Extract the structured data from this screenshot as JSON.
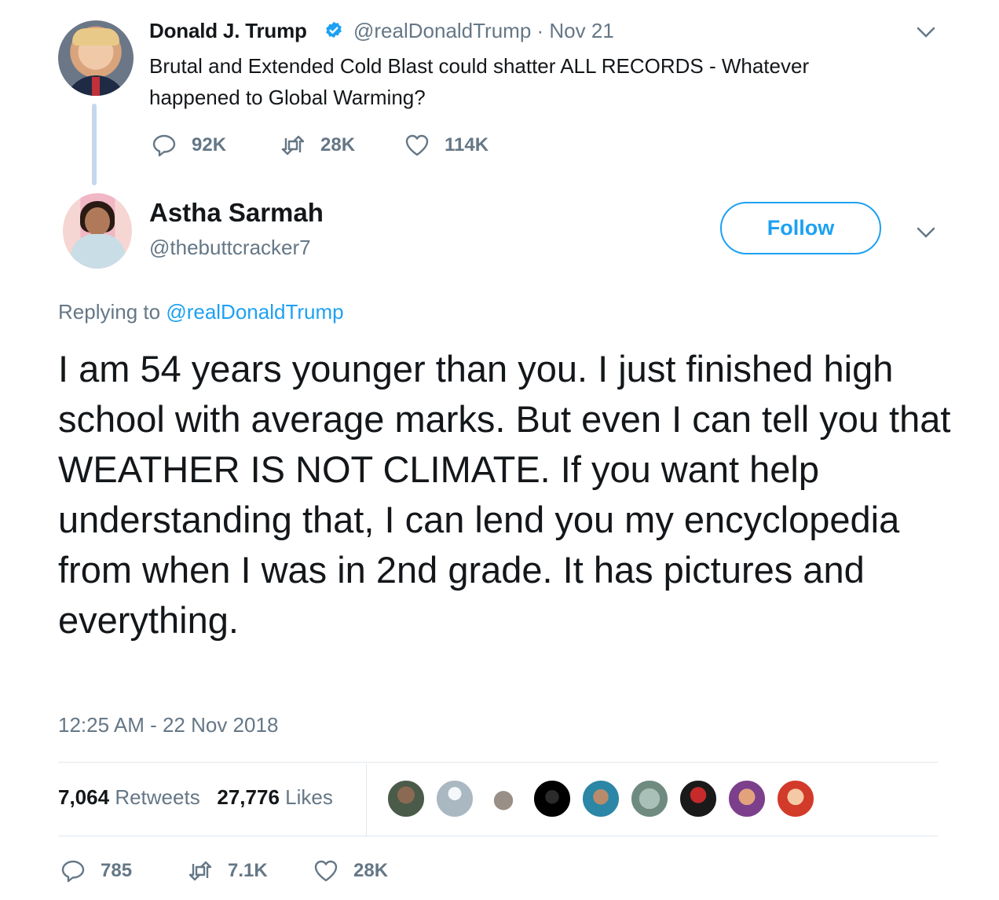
{
  "parent_tweet": {
    "name": "Donald J. Trump",
    "handle_date": "@realDonaldTrump · Nov 21",
    "text": "Brutal and Extended Cold Blast could shatter ALL RECORDS - Whatever happened to Global Warming?",
    "replies": "92K",
    "retweets": "28K",
    "likes": "114K"
  },
  "reply_tweet": {
    "name": "Astha Sarmah",
    "handle": "@thebuttcracker7",
    "follow_label": "Follow",
    "replying_prefix": "Replying to",
    "replying_handle": "@realDonaldTrump",
    "text": "I am 54 years younger than you. I just finished high school with average marks. But even I can tell you that  WEATHER IS NOT CLIMATE. If you want help understanding that, I can lend you my encyclopedia from when I was in 2nd grade. It has pictures and everything.",
    "timestamp": "12:25 AM - 22 Nov 2018",
    "retweet_count": "7,064",
    "retweet_label": "Retweets",
    "like_count": "27,776",
    "like_label": "Likes",
    "replies": "785",
    "retweets": "7.1K",
    "likes": "28K"
  },
  "colors": {
    "accent": "#1da1f2",
    "secondary_text": "#657786",
    "thread_line": "#c4d9ee"
  },
  "icons": [
    "verified-badge-icon",
    "chevron-down-icon",
    "reply-icon",
    "retweet-icon",
    "heart-icon"
  ]
}
